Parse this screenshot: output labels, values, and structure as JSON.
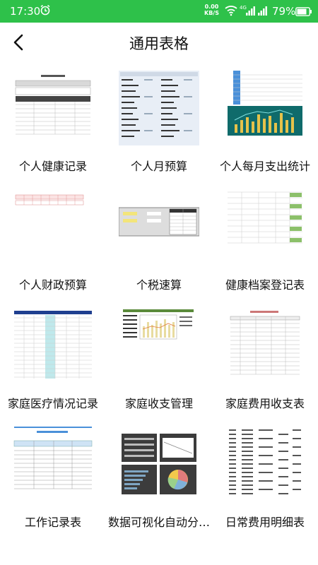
{
  "status_bar": {
    "time": "17:30",
    "net_speed_value": "0.00",
    "net_speed_unit": "KB/S",
    "network_type": "4G",
    "battery": "79%",
    "bar_color": "#2ec14a"
  },
  "header": {
    "title": "通用表格",
    "back_icon": "chevron-left-icon"
  },
  "templates": [
    {
      "label": "个人健康记录"
    },
    {
      "label": "个人月预算"
    },
    {
      "label": "个人每月支出统计"
    },
    {
      "label": "个人财政预算"
    },
    {
      "label": "个税速算"
    },
    {
      "label": "健康档案登记表"
    },
    {
      "label": "家庭医疗情况记录"
    },
    {
      "label": "家庭收支管理"
    },
    {
      "label": "家庭费用收支表"
    },
    {
      "label": "工作记录表"
    },
    {
      "label": "数据可视化自动分…"
    },
    {
      "label": "日常费用明细表"
    }
  ]
}
